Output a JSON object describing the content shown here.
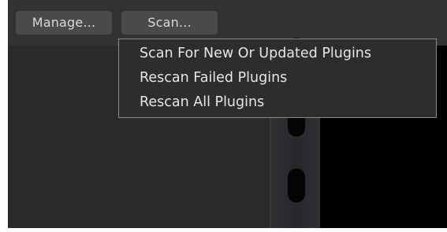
{
  "toolbar": {
    "manage_label": "Manage...",
    "scan_label": "Scan..."
  },
  "scan_menu": {
    "items": [
      {
        "label": "Scan For New Or Updated Plugins"
      },
      {
        "label": "Rescan Failed Plugins"
      },
      {
        "label": "Rescan All Plugins"
      }
    ]
  },
  "colors": {
    "window_background": "#2a2a2a",
    "button_background": "#4a4a4a",
    "menu_background": "#2d2d2d",
    "menu_border": "#8a8a8a",
    "text": "#e6e6e6",
    "right_panel": "#000000"
  }
}
